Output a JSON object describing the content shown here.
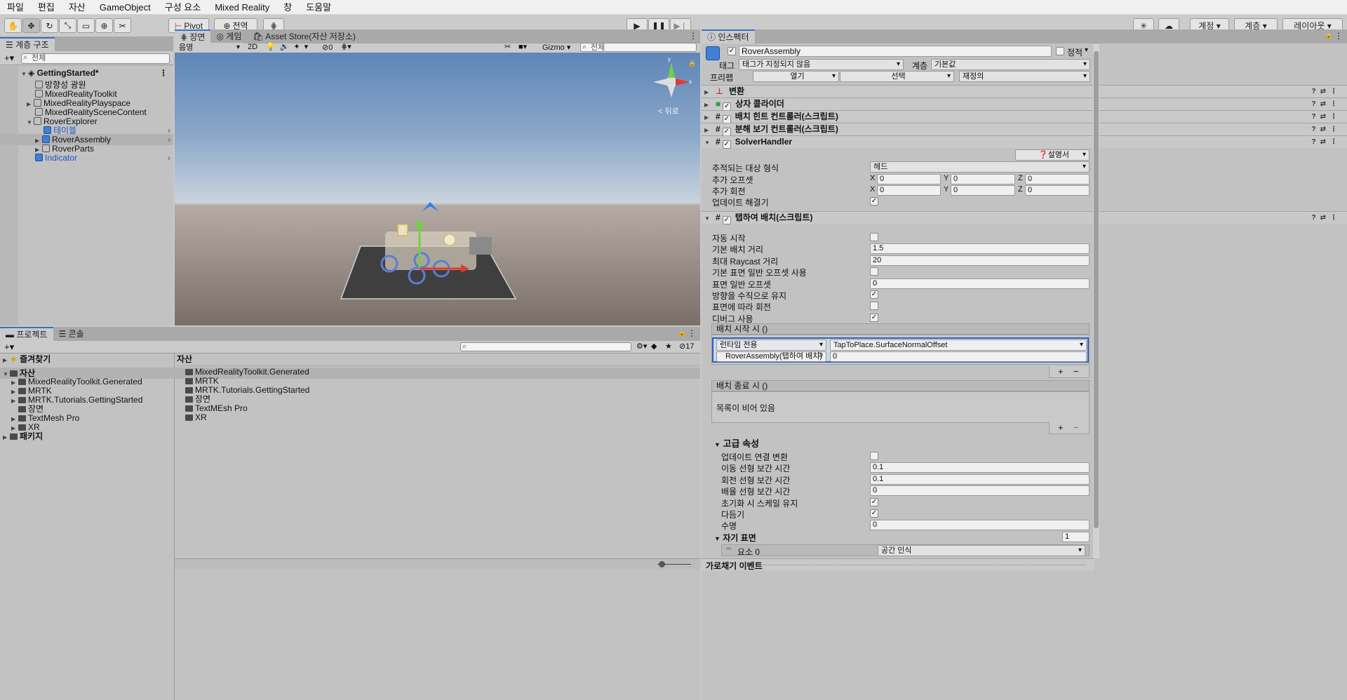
{
  "menu": [
    "파일",
    "편집",
    "자산",
    "GameObject",
    "구성 요소",
    "Mixed Reality",
    "창",
    "도움말"
  ],
  "toolbar": {
    "pivot": "Pivot",
    "global": "전역",
    "account": "계정",
    "layers": "계층",
    "layout": "레이아웃"
  },
  "hierarchy": {
    "tab": "계층 구조",
    "search_placeholder": "전체",
    "scene_name": "GettingStarted*",
    "items": [
      {
        "label": "방향성 광원",
        "indent": 2
      },
      {
        "label": "MixedRealityToolkit",
        "indent": 2
      },
      {
        "label": "MixedRealityPlayspace",
        "indent": 2
      },
      {
        "label": "MixedRealitySceneContent",
        "indent": 2
      },
      {
        "label": "RoverExplorer",
        "indent": 2
      },
      {
        "label": "테이블",
        "indent": 3
      },
      {
        "label": "RoverAssembly",
        "indent": 3
      },
      {
        "label": "RoverParts",
        "indent": 3
      },
      {
        "label": "Indicator",
        "indent": 2
      }
    ]
  },
  "scene": {
    "tabs": [
      "장면",
      "게임",
      "Asset Store(자산 저장소)"
    ],
    "shading": "음영",
    "mode2d": "2D",
    "hidden_count": "0",
    "gizmo": "Gizmo",
    "search_placeholder": "전체",
    "view_label": "< 뒤로"
  },
  "project": {
    "tabs": [
      "프로젝트",
      "콘솔"
    ],
    "favorites": "즐겨찾기",
    "assets": "자산",
    "packages": "패키지",
    "tree": [
      "MixedRealityToolkit.Generated",
      "MRTK",
      "MRTK.Tutorials.GettingStarted",
      "장면",
      "TextMesh Pro",
      "XR"
    ],
    "breadcrumb": "자산",
    "files": [
      "MixedRealityToolkit.Generated",
      "MRTK",
      "MRTK.Tutorials.GettingStarted",
      "장면",
      "TextMEsh Pro",
      "XR"
    ],
    "hidden_count": "17"
  },
  "inspector": {
    "tab": "인스펙터",
    "object_name": "RoverAssembly",
    "static_label": "정적",
    "tag_label": "태그",
    "tag_value": "태그가 지정되지 않음",
    "layer_label": "계층",
    "layer_value": "기본값",
    "prefab_label": "프리팹",
    "prefab_open": "열기",
    "prefab_select": "선택",
    "prefab_override": "재정의",
    "components": [
      "변환",
      "상자 콜라이더",
      "배치 힌트 컨트롤러(스크립트)",
      "분해 보기 컨트롤러(스크립트)",
      "SolverHandler"
    ],
    "docs_button": "설명서",
    "solver": {
      "tracked_type_label": "추적되는 대상 형식",
      "tracked_type_value": "헤드",
      "add_offset_label": "추가 오프셋",
      "add_rotation_label": "추가 회전",
      "update_solvers_label": "업데이트 해결기",
      "x": "X",
      "y": "Y",
      "z": "Z",
      "zero": "0"
    },
    "tap_to_place": {
      "title": "탭하여 배치(스크립트)",
      "props": [
        {
          "label": "자동 시작",
          "type": "check",
          "value": ""
        },
        {
          "label": "기본 배치 거리",
          "type": "field",
          "value": "1.5"
        },
        {
          "label": "최대 Raycast 거리",
          "type": "field",
          "value": "20"
        },
        {
          "label": "기본 표면 일반 오프셋 사용",
          "type": "check",
          "value": ""
        },
        {
          "label": "표면 일반 오프셋",
          "type": "field",
          "value": "0"
        },
        {
          "label": "방향을 수직으로 유지",
          "type": "check",
          "value": "✓"
        },
        {
          "label": "표면에 따라 회전",
          "type": "check",
          "value": ""
        },
        {
          "label": "디버그 사용",
          "type": "check",
          "value": "✓"
        }
      ],
      "on_start_label": "배치 시작 시 ()",
      "runtime_only": "런타임 전용",
      "function": "TapToPlace.SurfaceNormalOffset",
      "target": "RoverAssembly(탭하여 배치)",
      "arg": "0",
      "on_stop_label": "배치 종료 시 ()",
      "list_empty": "목록이 비어 있음"
    },
    "advanced": {
      "title": "고급 속성",
      "props": [
        {
          "label": "업데이트 연결 변환",
          "type": "check",
          "value": ""
        },
        {
          "label": "이동 선형 보간 시간",
          "type": "field",
          "value": "0.1"
        },
        {
          "label": "회전 선형 보간 시간",
          "type": "field",
          "value": "0.1"
        },
        {
          "label": "배율 선형 보간 시간",
          "type": "field",
          "value": "0"
        },
        {
          "label": "초기화 시 스케일 유지",
          "type": "check",
          "value": "✓"
        },
        {
          "label": "다듬기",
          "type": "check",
          "value": "✓"
        },
        {
          "label": "수명",
          "type": "field",
          "value": "0"
        }
      ],
      "magnetic_label": "자기 표면",
      "magnetic_count": "1",
      "element_label": "요소 0",
      "element_value": "공간 인식"
    },
    "footer": "가로채기 이벤트"
  }
}
